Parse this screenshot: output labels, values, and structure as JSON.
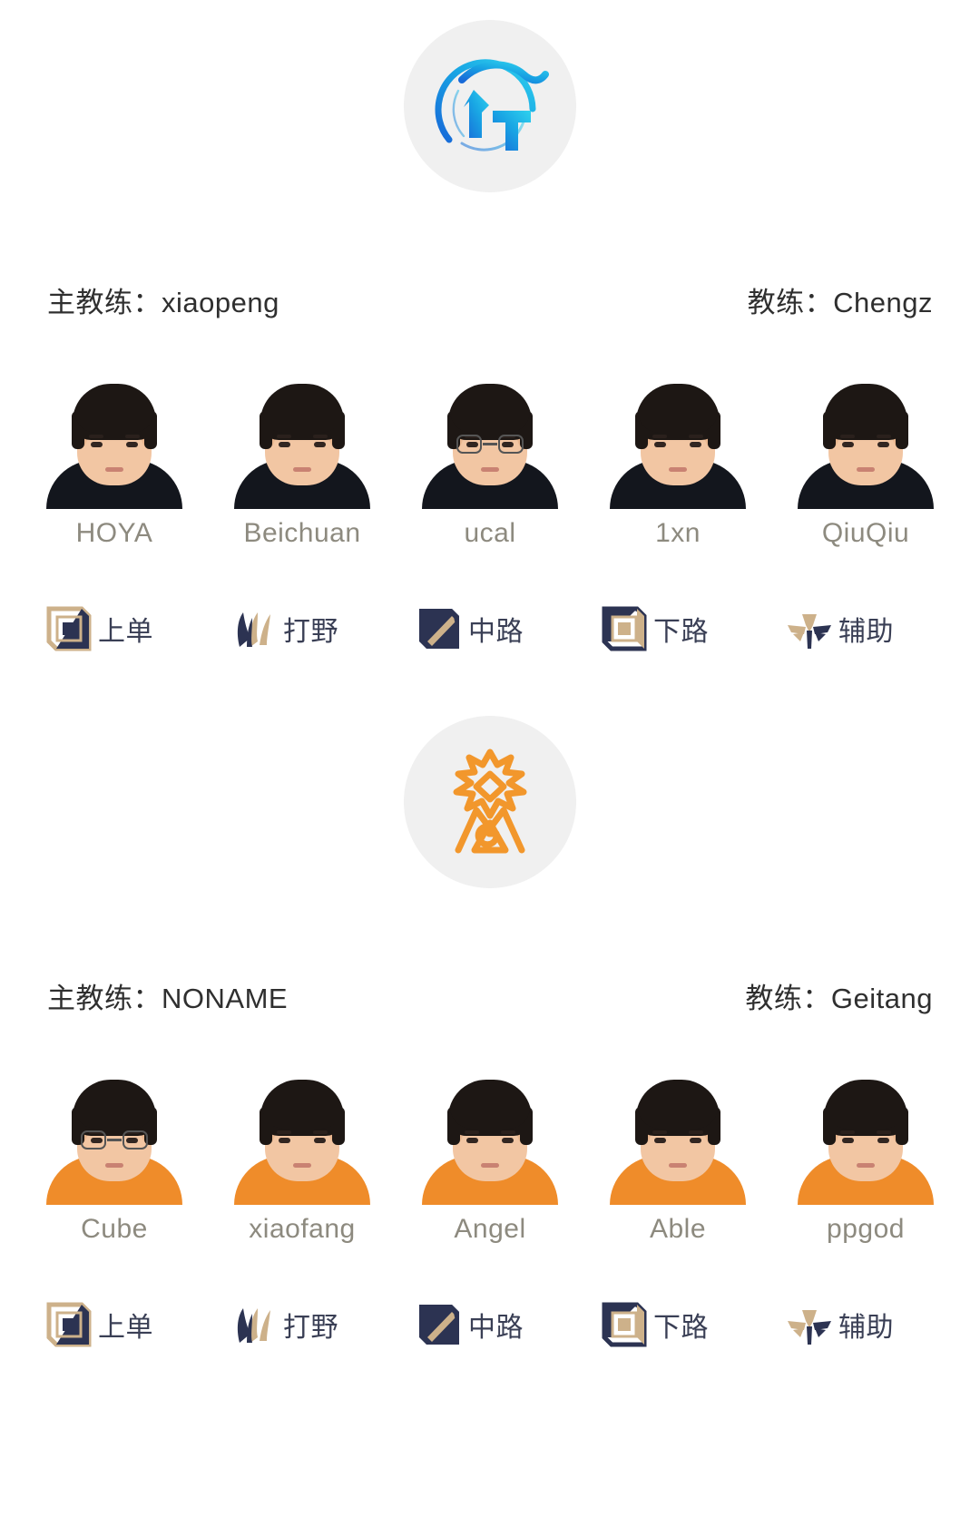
{
  "colors": {
    "team1_logo": "#22a7e0",
    "team2_logo": "#f2972c",
    "logo_bg": "#f0f0f0",
    "player_name": "#8d8a7f",
    "role_label": "#3a3f55",
    "role_gold": "#cdb18a",
    "role_navy": "#2c3352",
    "coach_text": "#2f2f2f"
  },
  "roles": [
    {
      "label": "上单",
      "icon": "top-lane-icon"
    },
    {
      "label": "打野",
      "icon": "jungle-icon"
    },
    {
      "label": "中路",
      "icon": "mid-lane-icon"
    },
    {
      "label": "下路",
      "icon": "bot-lane-icon"
    },
    {
      "label": "辅助",
      "icon": "support-icon"
    }
  ],
  "teams": [
    {
      "logo_name": "tt-team-logo",
      "head_coach": "主教练：xiaopeng",
      "coach": "教练：Chengz",
      "jersey": "#13161d",
      "players": [
        {
          "name": "HOYA",
          "glasses": false
        },
        {
          "name": "Beichuan",
          "glasses": false
        },
        {
          "name": "ucal",
          "glasses": true
        },
        {
          "name": "1xn",
          "glasses": false
        },
        {
          "name": "QiuQiu",
          "glasses": false
        }
      ]
    },
    {
      "logo_name": "lgd-team-logo",
      "head_coach": "主教练：NONAME",
      "coach": "教练：Geitang",
      "jersey": "#ef8c2a",
      "players": [
        {
          "name": "Cube",
          "glasses": true
        },
        {
          "name": "xiaofang",
          "glasses": false
        },
        {
          "name": "Angel",
          "glasses": false
        },
        {
          "name": "Able",
          "glasses": false
        },
        {
          "name": "ppgod",
          "glasses": false
        }
      ]
    }
  ]
}
